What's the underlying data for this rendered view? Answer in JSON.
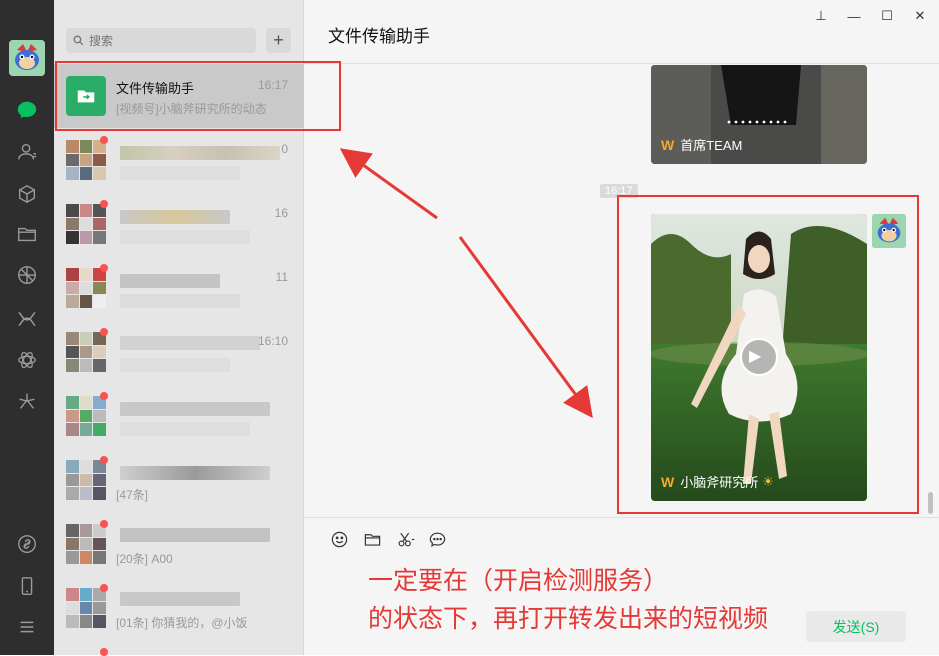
{
  "search": {
    "placeholder": "搜索"
  },
  "add_button": "+",
  "active_chat": {
    "title": "文件传输助手",
    "time": "16:17",
    "subtitle": "[视频号]小脑斧研究所的动态"
  },
  "conversation_times": [
    "0",
    "16",
    "11",
    "16:10",
    "",
    "",
    "",
    ""
  ],
  "conversation_subtitles": [
    "",
    "",
    "",
    "",
    "",
    "[47条]",
    "[20条] A00",
    "[01条] 你猜我的，@小饭"
  ],
  "chat": {
    "title": "文件传输助手",
    "timestamp": "16:17"
  },
  "cards": [
    {
      "author": "首席TEAM",
      "logo": "W"
    },
    {
      "author": "小脑斧研究所",
      "logo": "W",
      "badge": "☀"
    }
  ],
  "play_icon": "▶",
  "window_controls": {
    "pin": "⊥",
    "minimize": "—",
    "maximize": "☐",
    "close": "✕"
  },
  "annotation": {
    "line1": "一定要在（开启检测服务）",
    "line2": "的状态下，再打开转发出来的短视频"
  },
  "send_button": "发送(S)",
  "colors": {
    "accent": "#07c160",
    "annotation": "#e53935",
    "nav_bg": "#2e2e2e"
  }
}
